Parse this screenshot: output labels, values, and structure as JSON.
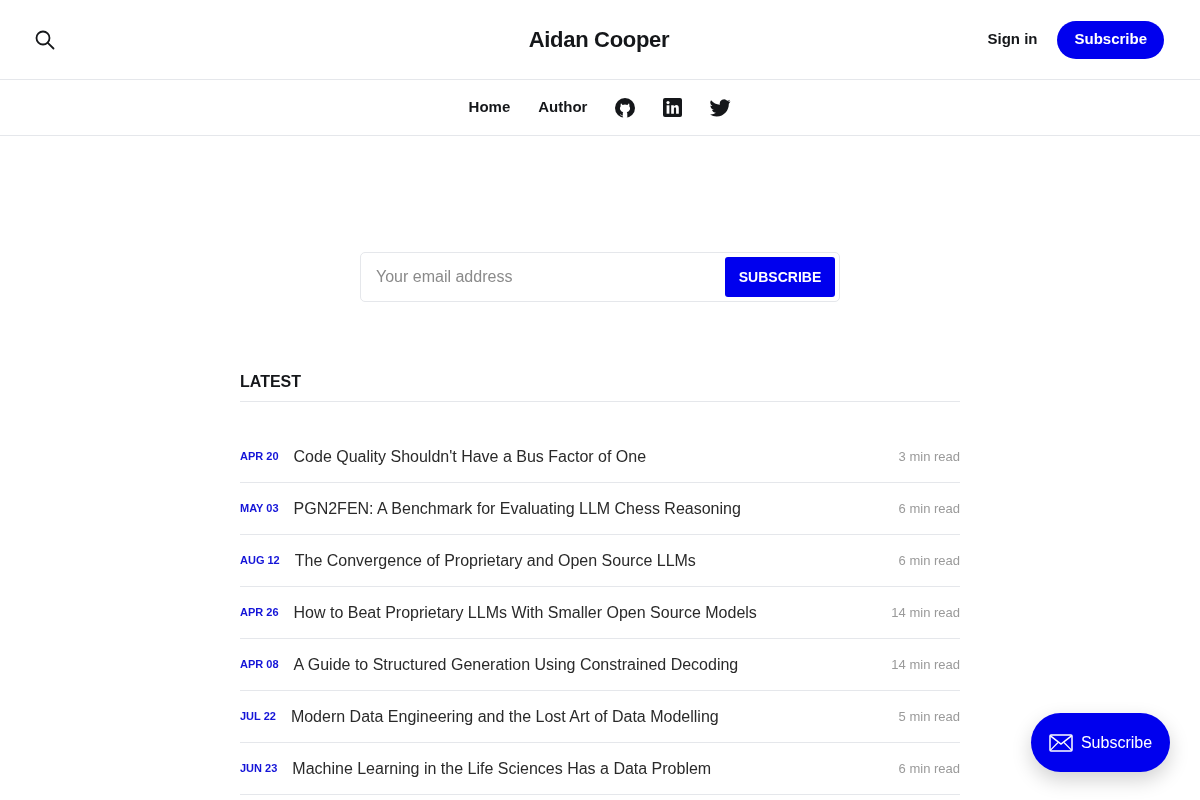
{
  "header": {
    "title": "Aidan Cooper",
    "sign_in": "Sign in",
    "subscribe": "Subscribe"
  },
  "nav": {
    "links": [
      "Home",
      "Author"
    ]
  },
  "signup": {
    "placeholder": "Your email address",
    "button": "SUBSCRIBE"
  },
  "latest": {
    "heading": "LATEST",
    "posts": [
      {
        "date": "APR 20",
        "title": "Code Quality Shouldn't Have a Bus Factor of One",
        "read_time": "3 min read"
      },
      {
        "date": "MAY 03",
        "title": "PGN2FEN: A Benchmark for Evaluating LLM Chess Reasoning",
        "read_time": "6 min read"
      },
      {
        "date": "AUG 12",
        "title": "The Convergence of Proprietary and Open Source LLMs",
        "read_time": "6 min read"
      },
      {
        "date": "APR 26",
        "title": "How to Beat Proprietary LLMs With Smaller Open Source Models",
        "read_time": "14 min read"
      },
      {
        "date": "APR 08",
        "title": "A Guide to Structured Generation Using Constrained Decoding",
        "read_time": "14 min read"
      },
      {
        "date": "JUL 22",
        "title": "Modern Data Engineering and the Lost Art of Data Modelling",
        "read_time": "5 min read"
      },
      {
        "date": "JUN 23",
        "title": "Machine Learning in the Life Sciences Has a Data Problem",
        "read_time": "6 min read"
      }
    ]
  },
  "portal_button": {
    "label": "Subscribe"
  }
}
